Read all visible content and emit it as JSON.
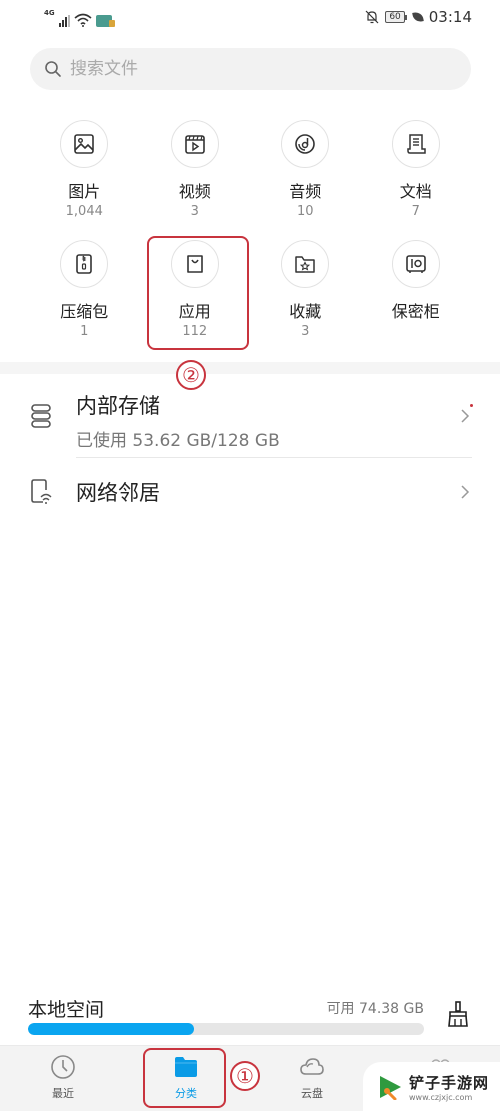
{
  "status_bar": {
    "network": "4G",
    "battery": "60",
    "time": "03:14"
  },
  "search": {
    "placeholder": "搜索文件"
  },
  "categories": [
    {
      "label": "图片",
      "count": "1,044",
      "icon": "image-icon"
    },
    {
      "label": "视频",
      "count": "3",
      "icon": "video-icon"
    },
    {
      "label": "音频",
      "count": "10",
      "icon": "audio-icon"
    },
    {
      "label": "文档",
      "count": "7",
      "icon": "document-icon"
    },
    {
      "label": "压缩包",
      "count": "1",
      "icon": "archive-icon"
    },
    {
      "label": "应用",
      "count": "112",
      "icon": "app-bag-icon"
    },
    {
      "label": "收藏",
      "count": "3",
      "icon": "favorites-icon"
    },
    {
      "label": "保密柜",
      "count": "",
      "icon": "safe-icon"
    }
  ],
  "annotations": {
    "step1": "①",
    "step2": "②",
    "color": "#c8343e"
  },
  "storage_list": [
    {
      "title": "内部存储",
      "subtitle": "已使用 53.62 GB/128 GB",
      "icon": "storage-icon"
    },
    {
      "title": "网络邻居",
      "subtitle": "",
      "icon": "network-neighbor-icon"
    }
  ],
  "local_space": {
    "title": "本地空间",
    "available": "可用 74.38 GB",
    "used_fraction": 0.42,
    "bar_color": "#0aa5f0"
  },
  "bottom_nav": [
    {
      "label": "最近",
      "icon": "clock-icon",
      "active": false
    },
    {
      "label": "分类",
      "icon": "folder-icon",
      "active": true
    },
    {
      "label": "云盘",
      "icon": "cloud-icon",
      "active": false
    },
    {
      "label": "",
      "icon": "more-icon",
      "active": false
    }
  ],
  "watermark": {
    "title": "铲子手游网",
    "url": "www.czjxjc.com"
  }
}
